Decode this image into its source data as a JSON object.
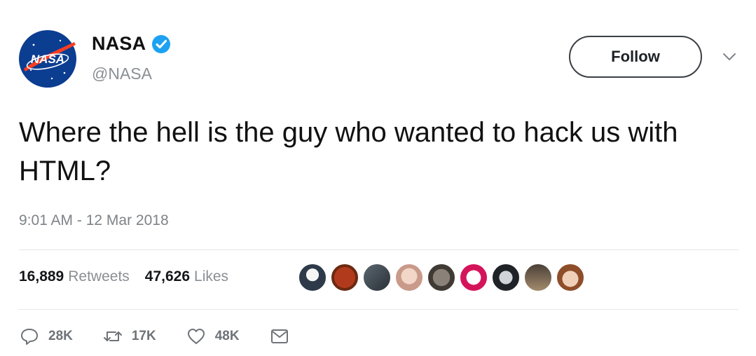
{
  "tweet": {
    "display_name": "NASA",
    "handle": "@NASA",
    "avatar_text": "NASA",
    "follow_label": "Follow",
    "text": "Where the hell is the guy who wanted to hack us with HTML?",
    "timestamp": "9:01 AM - 12 Mar 2018",
    "stats": {
      "retweets_count": "16,889",
      "retweets_label": "Retweets",
      "likes_count": "47,626",
      "likes_label": "Likes"
    },
    "actions": {
      "reply_count": "28K",
      "retweet_count": "17K",
      "like_count": "48K"
    }
  },
  "colors": {
    "verified": "#1da1f2",
    "nasa_blue": "#0b3d91",
    "nasa_red": "#fc3d21",
    "muted_text": "#8a8f94"
  },
  "liker_avatars": [
    "avatar-1",
    "avatar-2",
    "avatar-3",
    "avatar-4",
    "avatar-5",
    "avatar-6",
    "avatar-7",
    "avatar-8",
    "avatar-9"
  ]
}
